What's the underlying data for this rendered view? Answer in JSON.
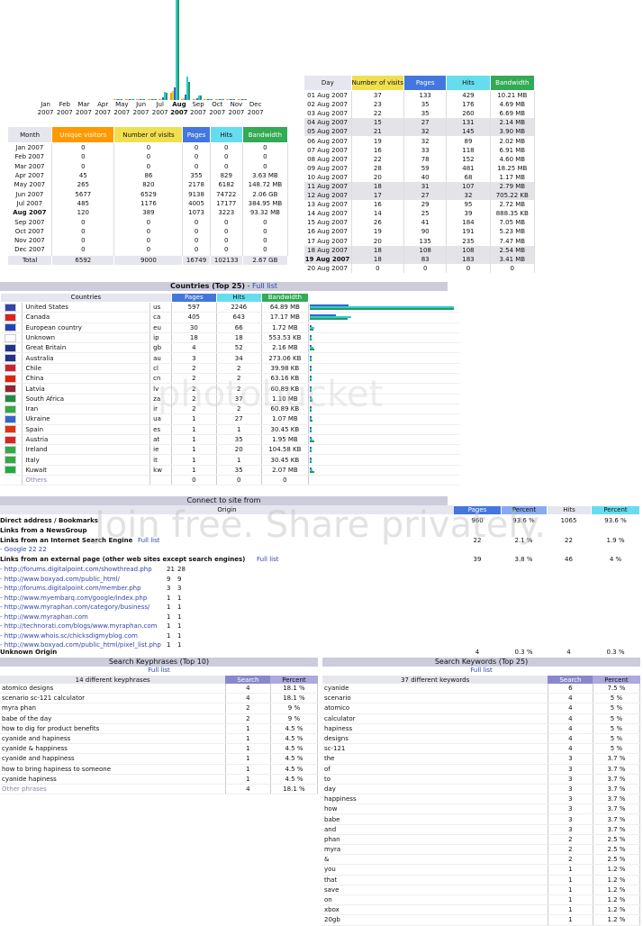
{
  "colors": {
    "unique": "#ff9900",
    "visits": "#f0e050",
    "pages": "#4477dd",
    "hits": "#66ddee",
    "bandwidth": "#33aa55",
    "bar_pages": "#3366cc",
    "bar_hits": "#33cccc",
    "bar_bw": "#229966",
    "bar_visits": "#ddcc44",
    "bar_unique": "#ff9900",
    "header": "#ccccdd"
  },
  "monthly": {
    "month_labels": [
      [
        "Jan",
        "2007"
      ],
      [
        "Feb",
        "2007"
      ],
      [
        "Mar",
        "2007"
      ],
      [
        "Apr",
        "2007"
      ],
      [
        "May",
        "2007"
      ],
      [
        "Jun",
        "2007"
      ],
      [
        "Jul",
        "2007"
      ],
      [
        "Aug",
        "2007"
      ],
      [
        "Sep",
        "2007"
      ],
      [
        "Oct",
        "2007"
      ],
      [
        "Nov",
        "2007"
      ],
      [
        "Dec",
        "2007"
      ]
    ],
    "headers": [
      "Month",
      "Unique visitors",
      "Number of visits",
      "Pages",
      "Hits",
      "Bandwidth"
    ],
    "rows": [
      [
        "Jan 2007",
        "0",
        "0",
        "0",
        "0",
        "0"
      ],
      [
        "Feb 2007",
        "0",
        "0",
        "0",
        "0",
        "0"
      ],
      [
        "Mar 2007",
        "0",
        "0",
        "0",
        "0",
        "0"
      ],
      [
        "Apr 2007",
        "45",
        "86",
        "355",
        "829",
        "3.63 MB"
      ],
      [
        "May 2007",
        "265",
        "820",
        "2178",
        "6182",
        "148.72 MB"
      ],
      [
        "Jun 2007",
        "5677",
        "6529",
        "9138",
        "74722",
        "2.06 GB"
      ],
      [
        "Jul 2007",
        "485",
        "1176",
        "4005",
        "17177",
        "384.95 MB"
      ],
      [
        "Aug 2007",
        "120",
        "389",
        "1073",
        "3223",
        "93.32 MB"
      ],
      [
        "Sep 2007",
        "0",
        "0",
        "0",
        "0",
        "0"
      ],
      [
        "Oct 2007",
        "0",
        "0",
        "0",
        "0",
        "0"
      ],
      [
        "Nov 2007",
        "0",
        "0",
        "0",
        "0",
        "0"
      ],
      [
        "Dec 2007",
        "0",
        "0",
        "0",
        "0",
        "0"
      ]
    ],
    "total": [
      "Total",
      "6592",
      "9000",
      "16749",
      "102133",
      "2.67 GB"
    ]
  },
  "daily": {
    "headers": [
      "Day",
      "Number of visits",
      "Pages",
      "Hits",
      "Bandwidth"
    ],
    "rows": [
      [
        "01 Aug 2007",
        "37",
        "133",
        "429",
        "10.21 MB"
      ],
      [
        "02 Aug 2007",
        "23",
        "35",
        "176",
        "4.69 MB"
      ],
      [
        "03 Aug 2007",
        "22",
        "35",
        "260",
        "6.69 MB"
      ],
      [
        "04 Aug 2007",
        "15",
        "27",
        "131",
        "2.14 MB"
      ],
      [
        "05 Aug 2007",
        "21",
        "32",
        "145",
        "3.90 MB"
      ],
      [
        "06 Aug 2007",
        "19",
        "32",
        "89",
        "2.02 MB"
      ],
      [
        "07 Aug 2007",
        "16",
        "33",
        "118",
        "6.91 MB"
      ],
      [
        "08 Aug 2007",
        "22",
        "78",
        "152",
        "4.60 MB"
      ],
      [
        "09 Aug 2007",
        "28",
        "59",
        "481",
        "18.25 MB"
      ],
      [
        "10 Aug 2007",
        "20",
        "40",
        "68",
        "1.17 MB"
      ],
      [
        "11 Aug 2007",
        "18",
        "31",
        "107",
        "2.79 MB"
      ],
      [
        "12 Aug 2007",
        "17",
        "27",
        "32",
        "705.22 KB"
      ],
      [
        "13 Aug 2007",
        "16",
        "29",
        "95",
        "2.72 MB"
      ],
      [
        "14 Aug 2007",
        "14",
        "25",
        "39",
        "888.35 KB"
      ],
      [
        "15 Aug 2007",
        "26",
        "41",
        "184",
        "7.05 MB"
      ],
      [
        "16 Aug 2007",
        "19",
        "90",
        "191",
        "5.23 MB"
      ],
      [
        "17 Aug 2007",
        "20",
        "135",
        "235",
        "7.47 MB"
      ],
      [
        "18 Aug 2007",
        "18",
        "108",
        "108",
        "2.54 MB"
      ],
      [
        "19 Aug 2007",
        "18",
        "83",
        "183",
        "3.41 MB"
      ],
      [
        "20 Aug 2007",
        "0",
        "0",
        "0",
        "0"
      ]
    ]
  },
  "countries": {
    "title": "Countries (Top 25)",
    "full_list": "Full list",
    "headers": [
      "Countries",
      "Pages",
      "Hits",
      "Bandwidth"
    ],
    "rows": [
      {
        "name": "United States",
        "code": "us",
        "pages": "597",
        "hits": "2246",
        "bw": "64.89 MB",
        "hits_frac": 1.0,
        "pages_frac": 0.266,
        "bw_frac": 1.0,
        "flag": "#3344aa"
      },
      {
        "name": "Canada",
        "code": "ca",
        "pages": "405",
        "hits": "643",
        "bw": "17.17 MB",
        "hits_frac": 0.286,
        "pages_frac": 0.18,
        "bw_frac": 0.265,
        "flag": "#dd2222"
      },
      {
        "name": "European country",
        "code": "eu",
        "pages": "30",
        "hits": "66",
        "bw": "1.72 MB",
        "hits_frac": 0.029,
        "pages_frac": 0.013,
        "bw_frac": 0.027,
        "flag": "#2244bb"
      },
      {
        "name": "Unknown",
        "code": "ip",
        "pages": "18",
        "hits": "18",
        "bw": "553.53 KB",
        "hits_frac": 0.008,
        "pages_frac": 0.008,
        "bw_frac": 0.008,
        "flag": "#ffffff"
      },
      {
        "name": "Great Britain",
        "code": "gb",
        "pages": "4",
        "hits": "52",
        "bw": "2.16 MB",
        "hits_frac": 0.023,
        "pages_frac": 0.002,
        "bw_frac": 0.033,
        "flag": "#223388"
      },
      {
        "name": "Australia",
        "code": "au",
        "pages": "3",
        "hits": "34",
        "bw": "273.06 KB",
        "hits_frac": 0.015,
        "pages_frac": 0.001,
        "bw_frac": 0.004,
        "flag": "#223388"
      },
      {
        "name": "Chile",
        "code": "cl",
        "pages": "2",
        "hits": "2",
        "bw": "39.98 KB",
        "hits_frac": 0.001,
        "pages_frac": 0.001,
        "bw_frac": 0.001,
        "flag": "#cc2233"
      },
      {
        "name": "China",
        "code": "cn",
        "pages": "2",
        "hits": "2",
        "bw": "63.16 KB",
        "hits_frac": 0.001,
        "pages_frac": 0.001,
        "bw_frac": 0.001,
        "flag": "#dd2211"
      },
      {
        "name": "Latvia",
        "code": "lv",
        "pages": "2",
        "hits": "2",
        "bw": "60.89 KB",
        "hits_frac": 0.001,
        "pages_frac": 0.001,
        "bw_frac": 0.001,
        "flag": "#992233"
      },
      {
        "name": "South Africa",
        "code": "za",
        "pages": "2",
        "hits": "37",
        "bw": "1.10 MB",
        "hits_frac": 0.016,
        "pages_frac": 0.001,
        "bw_frac": 0.017,
        "flag": "#228844"
      },
      {
        "name": "Iran",
        "code": "ir",
        "pages": "2",
        "hits": "2",
        "bw": "60.89 KB",
        "hits_frac": 0.001,
        "pages_frac": 0.001,
        "bw_frac": 0.001,
        "flag": "#33aa44"
      },
      {
        "name": "Ukraine",
        "code": "ua",
        "pages": "1",
        "hits": "27",
        "bw": "1.07 MB",
        "hits_frac": 0.012,
        "pages_frac": 0.0005,
        "bw_frac": 0.016,
        "flag": "#3366cc"
      },
      {
        "name": "Spain",
        "code": "es",
        "pages": "1",
        "hits": "1",
        "bw": "30.45 KB",
        "hits_frac": 0.0005,
        "pages_frac": 0.0005,
        "bw_frac": 0.0005,
        "flag": "#dd3311"
      },
      {
        "name": "Austria",
        "code": "at",
        "pages": "1",
        "hits": "35",
        "bw": "1.95 MB",
        "hits_frac": 0.016,
        "pages_frac": 0.0005,
        "bw_frac": 0.03,
        "flag": "#dd2222"
      },
      {
        "name": "Ireland",
        "code": "ie",
        "pages": "1",
        "hits": "20",
        "bw": "104.58 KB",
        "hits_frac": 0.009,
        "pages_frac": 0.0005,
        "bw_frac": 0.002,
        "flag": "#33aa44"
      },
      {
        "name": "Italy",
        "code": "it",
        "pages": "1",
        "hits": "1",
        "bw": "30.45 KB",
        "hits_frac": 0.0005,
        "pages_frac": 0.0005,
        "bw_frac": 0.0005,
        "flag": "#33aa44"
      },
      {
        "name": "Kuwait",
        "code": "kw",
        "pages": "1",
        "hits": "35",
        "bw": "2.07 MB",
        "hits_frac": 0.016,
        "pages_frac": 0.0005,
        "bw_frac": 0.032,
        "flag": "#22aa44"
      }
    ],
    "others": {
      "name": "Others",
      "pages": "0",
      "hits": "0",
      "bw": "0"
    }
  },
  "connect": {
    "title": "Connect to site from",
    "origin_header": "Origin",
    "headers": [
      "Pages",
      "Percent",
      "Hits",
      "Percent"
    ],
    "direct": {
      "label": "Direct address / Bookmarks",
      "pages": "960",
      "ppct": "93.6 %",
      "hits": "1065",
      "hpct": "93.6 %"
    },
    "newsgroup": {
      "label": "Links from a NewsGroup"
    },
    "search": {
      "label": "Links from an Internet Search Engine",
      "full_list": "Full list",
      "pages": "22",
      "ppct": "2.1 %",
      "hits": "22",
      "hpct": "1.9 %",
      "google": "- Google 22 22"
    },
    "external": {
      "label": "Links from an external page (other web sites except search engines)",
      "full_list": "Full list",
      "pages": "39",
      "ppct": "3.8 %",
      "hits": "46",
      "hpct": "4 %",
      "links": [
        {
          "url": "- http://forums.digitalpoint.com/showthread.php",
          "a": "21",
          "b": "28"
        },
        {
          "url": "- http://www.boxyad.com/public_html/",
          "a": "9",
          "b": "9"
        },
        {
          "url": "- http://forums.digitalpoint.com/member.php",
          "a": "3",
          "b": "3"
        },
        {
          "url": "- http://www.myembarq.com/google/index.php",
          "a": "1",
          "b": "1"
        },
        {
          "url": "- http://www.myraphan.com/category/business/",
          "a": "1",
          "b": "1"
        },
        {
          "url": "- http://www.myraphan.com",
          "a": "1",
          "b": "1"
        },
        {
          "url": "- http://technorati.com/blogs/www.myraphan.com",
          "a": "1",
          "b": "1"
        },
        {
          "url": "- http://www.whois.sc/chicksdigmyblog.com",
          "a": "1",
          "b": "1"
        },
        {
          "url": "- http://www.boxyad.com/public_html/pixel_list.php",
          "a": "1",
          "b": "1"
        }
      ]
    },
    "unknown": {
      "label": "Unknown Origin",
      "pages": "4",
      "ppct": "0.3 %",
      "hits": "4",
      "hpct": "0.3 %"
    }
  },
  "keyphrases": {
    "title": "Search Keyphrases (Top 10)",
    "full_list": "Full list",
    "count_label": "14 different keyphrases",
    "headers": [
      "Search",
      "Percent"
    ],
    "rows": [
      [
        "atomico designs",
        "4",
        "18.1 %"
      ],
      [
        "scenario sc-121 calculator",
        "4",
        "18.1 %"
      ],
      [
        "myra phan",
        "2",
        "9 %"
      ],
      [
        "babe of the day",
        "2",
        "9 %"
      ],
      [
        "how to dig for product benefits",
        "1",
        "4.5 %"
      ],
      [
        "cyanide and hapiness",
        "1",
        "4.5 %"
      ],
      [
        "cyanide & happiness",
        "1",
        "4.5 %"
      ],
      [
        "cyanide and happiness",
        "1",
        "4.5 %"
      ],
      [
        "how to bring hapiness to someone",
        "1",
        "4.5 %"
      ],
      [
        "cyanide hapiness",
        "1",
        "4.5 %"
      ]
    ],
    "other": [
      "Other phrases",
      "4",
      "18.1 %"
    ]
  },
  "keywords": {
    "title": "Search Keywords (Top 25)",
    "full_list": "Full list",
    "count_label": "37 different keywords",
    "headers": [
      "Search",
      "Percent"
    ],
    "rows": [
      [
        "cyanide",
        "6",
        "7.5 %"
      ],
      [
        "scenario",
        "4",
        "5 %"
      ],
      [
        "atomico",
        "4",
        "5 %"
      ],
      [
        "calculator",
        "4",
        "5 %"
      ],
      [
        "hapiness",
        "4",
        "5 %"
      ],
      [
        "designs",
        "4",
        "5 %"
      ],
      [
        "sc-121",
        "4",
        "5 %"
      ],
      [
        "the",
        "3",
        "3.7 %"
      ],
      [
        "of",
        "3",
        "3.7 %"
      ],
      [
        "to",
        "3",
        "3.7 %"
      ],
      [
        "day",
        "3",
        "3.7 %"
      ],
      [
        "happiness",
        "3",
        "3.7 %"
      ],
      [
        "how",
        "3",
        "3.7 %"
      ],
      [
        "babe",
        "3",
        "3.7 %"
      ],
      [
        "and",
        "3",
        "3.7 %"
      ],
      [
        "phan",
        "2",
        "2.5 %"
      ],
      [
        "myra",
        "2",
        "2.5 %"
      ],
      [
        "&",
        "2",
        "2.5 %"
      ],
      [
        "you",
        "1",
        "1.2 %"
      ],
      [
        "that",
        "1",
        "1.2 %"
      ],
      [
        "save",
        "1",
        "1.2 %"
      ],
      [
        "on",
        "1",
        "1.2 %"
      ],
      [
        "xbox",
        "1",
        "1.2 %"
      ],
      [
        "20gb",
        "1",
        "1.2 %"
      ]
    ]
  },
  "watermark": {
    "line1": "photobucket",
    "line2": "Join free. Share privately."
  }
}
